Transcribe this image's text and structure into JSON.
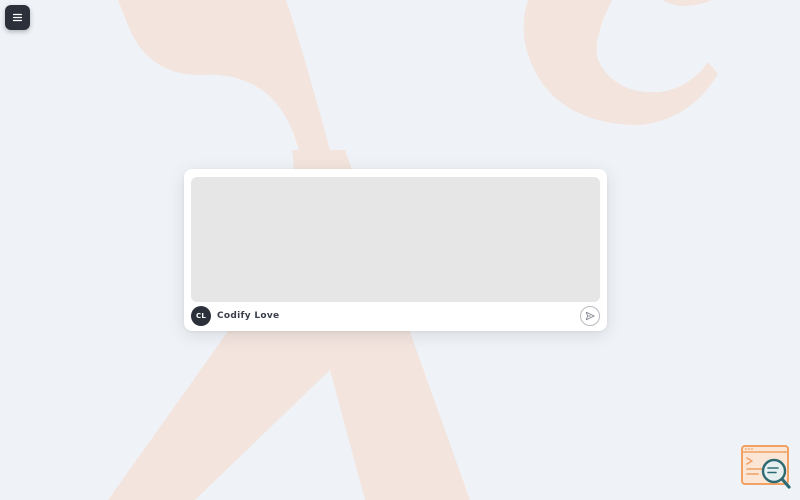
{
  "colors": {
    "background": "#eff3f8",
    "decor": "#f3e4de",
    "dark": "#2b303b",
    "textarea_bg": "#e6e6e6",
    "logo_orange": "#f0a164",
    "logo_teal": "#2e6a73"
  },
  "menu": {
    "icon": "hamburger-icon"
  },
  "composer": {
    "text_value": "",
    "placeholder": "",
    "author": {
      "initials": "CL",
      "name": "Codify Love"
    },
    "send_icon": "send-icon"
  },
  "logo": {
    "icon": "code-search-logo"
  }
}
